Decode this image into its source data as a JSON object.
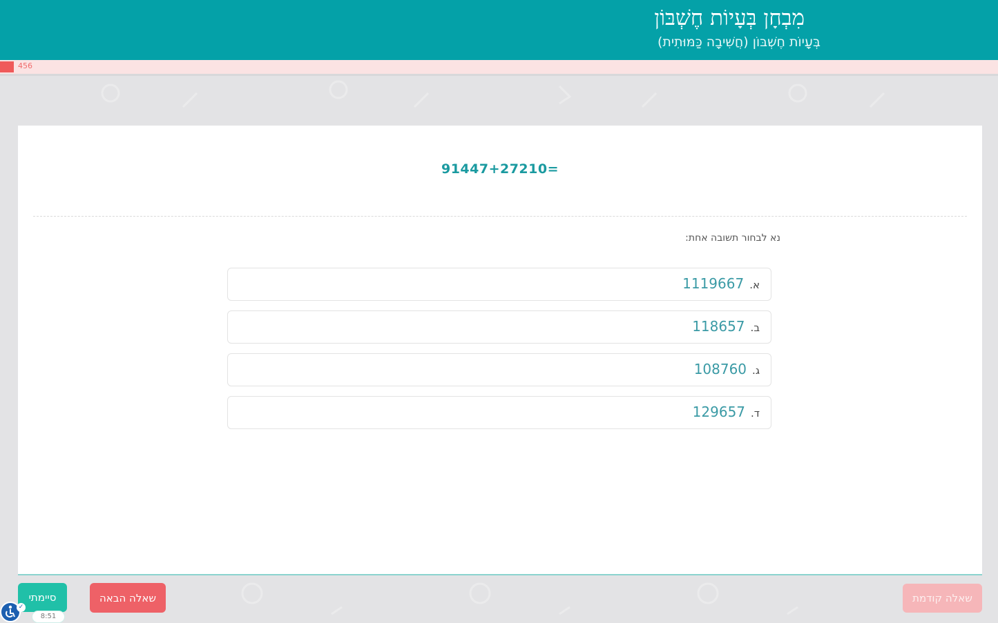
{
  "header": {
    "title": "מִבְחָן בְּעָיוֹת חֶשְׁבּוֹן",
    "subtitle": "בְּעָיוֹת חֶשְׁבּוֹן (חֲשִׁיבָה כַּמּוּתִית)"
  },
  "progress": {
    "label": "456",
    "fraction": 0.014
  },
  "question": {
    "text": "91447+27210="
  },
  "instruction": "נא לבחור תשובה אחת:",
  "options": [
    {
      "letter": "א.",
      "value": "1119667"
    },
    {
      "letter": "ב.",
      "value": "118657"
    },
    {
      "letter": "ג.",
      "value": "108760"
    },
    {
      "letter": "ד.",
      "value": "129657"
    }
  ],
  "buttons": {
    "finish": "סיימתי",
    "next": "שאלה הבאה",
    "prev": "שאלה קודמת"
  },
  "timer": "8:51",
  "colors": {
    "header": "#04a1a8",
    "next_button": "#ee6167",
    "finish_button": "#20c0a8",
    "prev_button_disabled": "#f6b6b9",
    "progress_fill": "#ef5a5a"
  },
  "icons": {
    "accessibility": "accessibility-icon"
  }
}
